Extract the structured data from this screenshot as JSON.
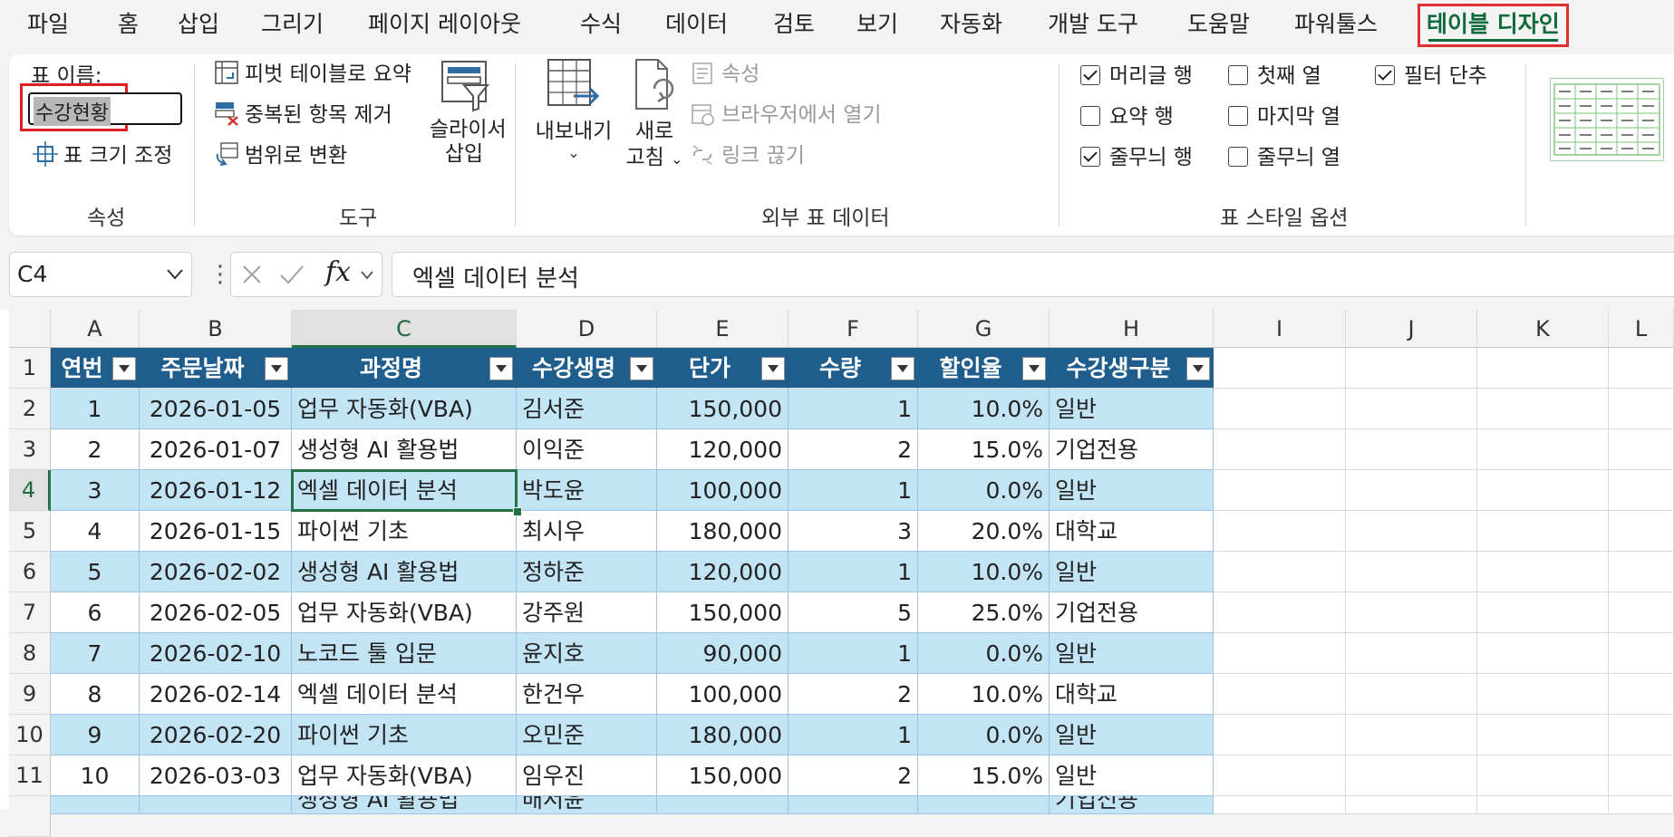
{
  "menu": {
    "tabs": [
      "파일",
      "홈",
      "삽입",
      "그리기",
      "페이지 레이아웃",
      "수식",
      "데이터",
      "검토",
      "보기",
      "자동화",
      "개발 도구",
      "도움말",
      "파워툴스",
      "테이블 디자인"
    ],
    "active": "테이블 디자인"
  },
  "ribbon": {
    "props": {
      "table_name_label": "표 이름:",
      "table_name_value": "수강현황",
      "resize_label": "표 크기 조정",
      "group_label": "속성"
    },
    "tools": {
      "pivot": "피벗 테이블로 요약",
      "remove_dup": "중복된 항목 제거",
      "to_range": "범위로 변환",
      "slicer_line1": "슬라이서",
      "slicer_line2": "삽입",
      "group_label": "도구"
    },
    "external": {
      "export_label": "내보내기",
      "refresh_line1": "새로",
      "refresh_line2": "고침",
      "properties": "속성",
      "open_browser": "브라우저에서 열기",
      "unlink": "링크 끊기",
      "group_label": "외부 표 데이터"
    },
    "style_options": {
      "header_row": "머리글 행",
      "first_col": "첫째 열",
      "filter_btn": "필터 단추",
      "total_row": "요약 행",
      "last_col": "마지막 열",
      "banded_rows": "줄무늬 행",
      "banded_cols": "줄무늬 열",
      "group_label": "표 스타일 옵션",
      "checked": {
        "header_row": true,
        "first_col": false,
        "filter_btn": true,
        "total_row": false,
        "last_col": false,
        "banded_rows": true,
        "banded_cols": false
      }
    }
  },
  "formula_bar": {
    "name_box": "C4",
    "fx": "fx",
    "content": "엑셀 데이터 분석"
  },
  "sheet": {
    "columns": [
      "A",
      "B",
      "C",
      "D",
      "E",
      "F",
      "G",
      "H",
      "I",
      "J",
      "K",
      "L"
    ],
    "selected_col": "C",
    "selected_row": "4",
    "row_numbers": [
      "1",
      "2",
      "3",
      "4",
      "5",
      "6",
      "7",
      "8",
      "9",
      "10",
      "11"
    ],
    "table_headers": [
      "연번",
      "주문날짜",
      "과정명",
      "수강생명",
      "단가",
      "수량",
      "할인율",
      "수강생구분"
    ],
    "rows": [
      [
        "1",
        "2026-01-05",
        "업무 자동화(VBA)",
        "김서준",
        "150,000",
        "1",
        "10.0%",
        "일반"
      ],
      [
        "2",
        "2026-01-07",
        "생성형 AI 활용법",
        "이익준",
        "120,000",
        "2",
        "15.0%",
        "기업전용"
      ],
      [
        "3",
        "2026-01-12",
        "엑셀 데이터 분석",
        "박도윤",
        "100,000",
        "1",
        "0.0%",
        "일반"
      ],
      [
        "4",
        "2026-01-15",
        "파이썬 기초",
        "최시우",
        "180,000",
        "3",
        "20.0%",
        "대학교"
      ],
      [
        "5",
        "2026-02-02",
        "생성형 AI 활용법",
        "정하준",
        "120,000",
        "1",
        "10.0%",
        "일반"
      ],
      [
        "6",
        "2026-02-05",
        "업무 자동화(VBA)",
        "강주원",
        "150,000",
        "5",
        "25.0%",
        "기업전용"
      ],
      [
        "7",
        "2026-02-10",
        "노코드 툴 입문",
        "윤지호",
        "90,000",
        "1",
        "0.0%",
        "일반"
      ],
      [
        "8",
        "2026-02-14",
        "엑셀 데이터 분석",
        "한건우",
        "100,000",
        "2",
        "10.0%",
        "대학교"
      ],
      [
        "9",
        "2026-02-20",
        "파이썬 기초",
        "오민준",
        "180,000",
        "1",
        "0.0%",
        "일반"
      ],
      [
        "10",
        "2026-03-03",
        "업무 자동화(VBA)",
        "임우진",
        "150,000",
        "2",
        "15.0%",
        "일반"
      ]
    ],
    "partial_row": [
      "",
      "",
      "생성형 AI 활용법",
      "배서윤",
      "",
      "",
      "",
      "기업전용"
    ],
    "colors": {
      "header": "#1f5d8c",
      "band": "#c3e4f4",
      "border": "#9dc3e6",
      "accent": "#217346"
    }
  }
}
